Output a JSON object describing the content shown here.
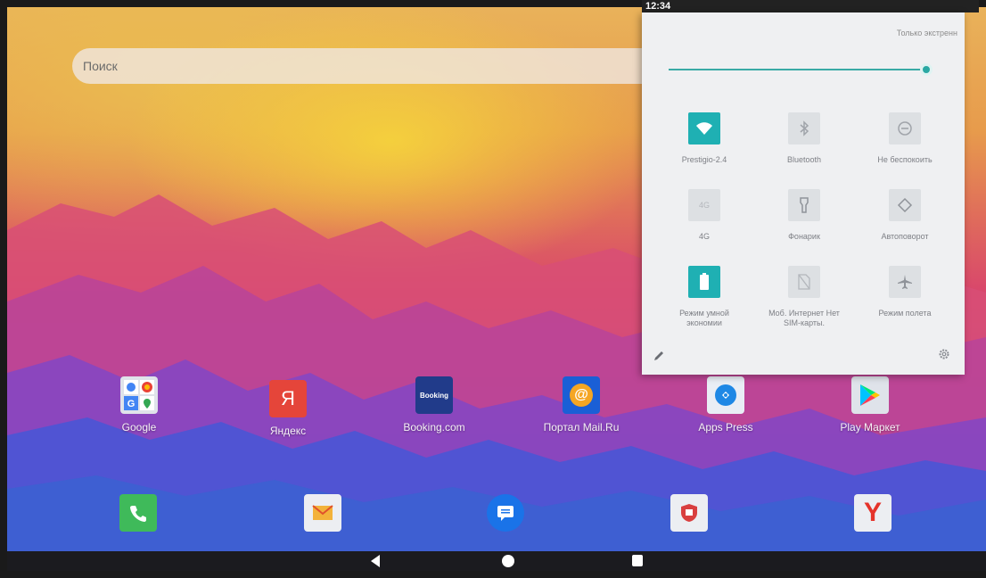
{
  "status_bar": {
    "time": "12:34"
  },
  "search": {
    "placeholder": "Поиск"
  },
  "apps": [
    {
      "label": "Google",
      "icon": "google-folder-icon"
    },
    {
      "label": "Яндекс",
      "icon": "yandex-icon",
      "glyph": "Я"
    },
    {
      "label": "Booking.com",
      "icon": "booking-icon",
      "glyph": "Booking"
    },
    {
      "label": "Портал Mail.Ru",
      "icon": "mailru-icon",
      "glyph": "@"
    },
    {
      "label": "Apps Press",
      "icon": "apps-press-icon"
    },
    {
      "label": "Play Маркет",
      "icon": "play-market-icon"
    }
  ],
  "dock": [
    {
      "icon": "phone-icon"
    },
    {
      "icon": "email-icon"
    },
    {
      "icon": "messages-icon"
    },
    {
      "icon": "shield-app-icon"
    },
    {
      "icon": "yandex-browser-icon",
      "glyph": "Y"
    }
  ],
  "quick_settings": {
    "dnd_label": "Только экстренн",
    "brightness": 1.0,
    "tiles": [
      {
        "label": "Prestigio-2.4",
        "icon": "wifi-icon",
        "active": true
      },
      {
        "label": "Bluetooth",
        "icon": "bluetooth-icon",
        "active": false
      },
      {
        "label": "Не беспокоить",
        "icon": "do-not-disturb-icon",
        "active": false
      },
      {
        "label": "4G",
        "icon": "4g-icon",
        "glyph": "4G",
        "active": false
      },
      {
        "label": "Фонарик",
        "icon": "flashlight-icon",
        "active": false
      },
      {
        "label": "Автоповорот",
        "icon": "auto-rotate-icon",
        "active": false
      },
      {
        "label": "Режим умной экономии",
        "icon": "battery-saver-icon",
        "active": true
      },
      {
        "label": "Моб. Интернет Нет SIM-карты.",
        "icon": "no-sim-icon",
        "active": false
      },
      {
        "label": "Режим полета",
        "icon": "airplane-icon",
        "active": false
      }
    ]
  },
  "colors": {
    "accent": "#1fb0b3",
    "panel": "#eff0f2",
    "navbar": "#1b1b1f"
  }
}
